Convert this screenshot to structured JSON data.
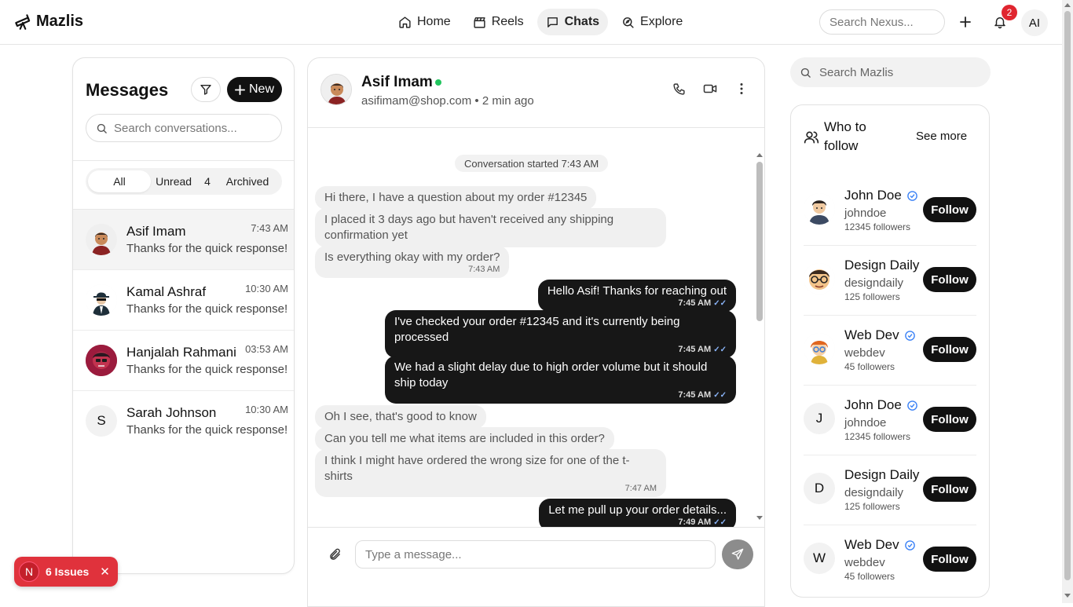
{
  "app": {
    "name": "Mazlis"
  },
  "nav": [
    {
      "label": "Home",
      "icon": "home-icon"
    },
    {
      "label": "Reels",
      "icon": "clapperboard-icon"
    },
    {
      "label": "Chats",
      "icon": "chat-icon",
      "active": true
    },
    {
      "label": "Explore",
      "icon": "compass-icon"
    }
  ],
  "topbar": {
    "search_placeholder": "Search Nexus...",
    "notification_count": "2",
    "user_initials": "AI"
  },
  "messages": {
    "title": "Messages",
    "new_label": "New",
    "search_placeholder": "Search conversations...",
    "tabs": {
      "all": "All",
      "unread": "Unread",
      "unread_count": "4",
      "archived": "Archived"
    },
    "conversations": [
      {
        "name": "Asif Imam",
        "time": "7:43 AM",
        "preview": "Thanks for the quick response!",
        "avatar": "cartoon-man-avatar"
      },
      {
        "name": "Kamal Ashraf",
        "time": "10:30 AM",
        "preview": "Thanks for the quick response!",
        "avatar": "spy-avatar"
      },
      {
        "name": "Hanjalah Rahmani",
        "time": "03:53 AM",
        "preview": "Thanks for the quick response!",
        "avatar": "red-character-avatar"
      },
      {
        "name": "Sarah Johnson",
        "time": "10:30 AM",
        "preview": "Thanks for the quick response!",
        "avatar_initial": "S"
      }
    ]
  },
  "chat": {
    "name": "Asif Imam",
    "subtitle": "asifimam@shop.com • 2 min ago",
    "system_message": "Conversation started 7:43 AM",
    "messages": [
      {
        "dir": "in",
        "text": "Hi there, I have a question about my order #12345",
        "time": ""
      },
      {
        "dir": "in",
        "text": "I placed it 3 days ago but haven't received any shipping confirmation yet",
        "time": ""
      },
      {
        "dir": "in",
        "text": "Is everything okay with my order?",
        "time": "7:43 AM"
      },
      {
        "dir": "out",
        "text": "Hello Asif! Thanks for reaching out",
        "time": "7:45 AM"
      },
      {
        "dir": "out",
        "text": "I've checked your order #12345 and it's currently being processed",
        "time": "7:45 AM"
      },
      {
        "dir": "out",
        "text": "We had a slight delay due to high order volume but it should ship today",
        "time": "7:45 AM"
      },
      {
        "dir": "in",
        "text": "Oh I see, that's good to know",
        "time": ""
      },
      {
        "dir": "in",
        "text": "Can you tell me what items are included in this order?",
        "time": ""
      },
      {
        "dir": "in",
        "text": "I think I might have ordered the wrong size for one of the t-shirts",
        "time": "7:47 AM"
      },
      {
        "dir": "out",
        "text": "Let me pull up your order details...",
        "time": "7:49 AM"
      }
    ],
    "input_placeholder": "Type a message..."
  },
  "sidebar": {
    "search_placeholder": "Search Mazlis",
    "who_to_follow": "Who to follow",
    "see_more": "See more",
    "suggestions": [
      {
        "name": "John Doe",
        "verified": true,
        "handle": "johndoe",
        "followers": "12345 followers",
        "button": "Follow",
        "avatar": "cartoon-man-avatar"
      },
      {
        "name": "Design Daily",
        "verified": false,
        "handle": "designdaily",
        "followers": "125 followers",
        "button": "Follow",
        "avatar": "glasses-man-avatar"
      },
      {
        "name": "Web Dev",
        "verified": true,
        "handle": "webdev",
        "followers": "45 followers",
        "button": "Follow",
        "avatar": "redhead-avatar"
      },
      {
        "name": "John Doe",
        "verified": true,
        "handle": "johndoe",
        "followers": "12345 followers",
        "button": "Follow",
        "avatar_initial": "J"
      },
      {
        "name": "Design Daily",
        "verified": false,
        "handle": "designdaily",
        "followers": "125 followers",
        "button": "Follow",
        "avatar_initial": "D"
      },
      {
        "name": "Web Dev",
        "verified": true,
        "handle": "webdev",
        "followers": "45 followers",
        "button": "Follow",
        "avatar_initial": "W"
      }
    ]
  },
  "issues": {
    "badge": "N",
    "label": "6 Issues"
  },
  "colors": {
    "accent": "#111111",
    "online": "#22c55e",
    "badge": "#e0252f",
    "issues": "#e0323c",
    "verified": "#3b82f6"
  }
}
